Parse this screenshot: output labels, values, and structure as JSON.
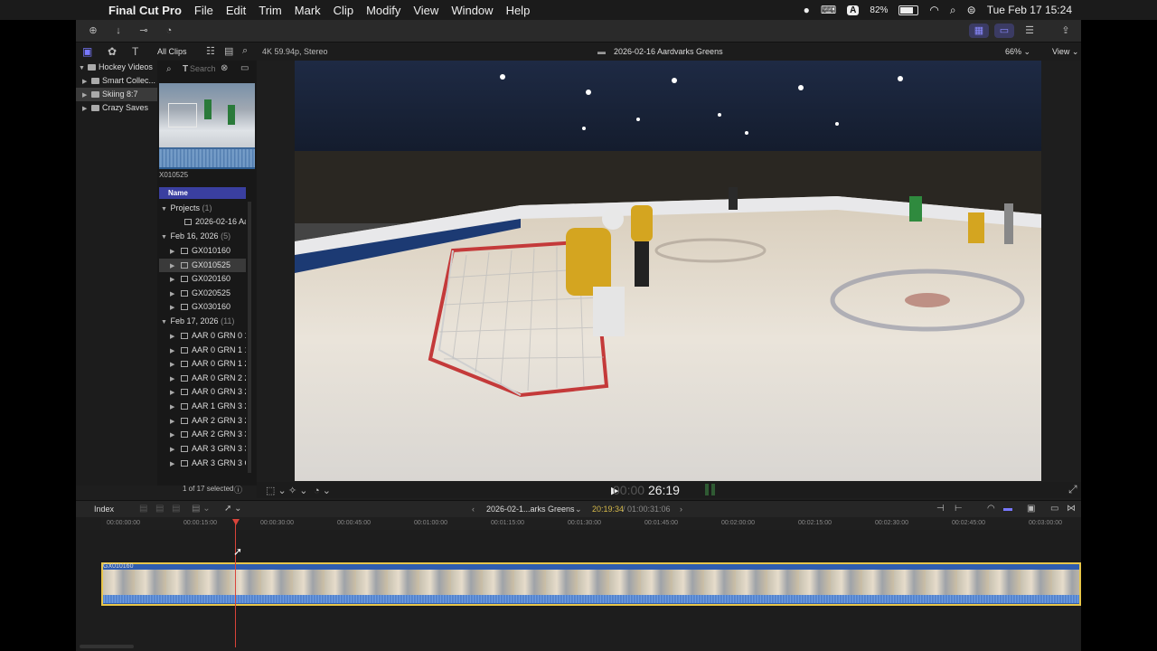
{
  "menubar": {
    "apple": "",
    "app_name": "Final Cut Pro",
    "menus": [
      "File",
      "Edit",
      "Trim",
      "Mark",
      "Clip",
      "Modify",
      "View",
      "Window",
      "Help"
    ],
    "battery": "82%",
    "battery_level": 0.82,
    "keyboard": "A",
    "clock": "Tue Feb 17  15:24"
  },
  "browser": {
    "clips_filter": "All Clips",
    "search_placeholder": "Search",
    "library": {
      "name": "Hockey Videos",
      "items": [
        "Smart Collec...",
        "Skiing 8:7",
        "Crazy Saves"
      ]
    },
    "preview_clip": "X010525",
    "column_header": "Name",
    "projects": {
      "label": "Projects",
      "count": "(1)",
      "items": [
        "2026-02-16 Aa"
      ]
    },
    "events": [
      {
        "label": "Feb 16, 2026",
        "count": "(5)",
        "clips": [
          "GX010160",
          "GX010525",
          "GX020160",
          "GX020525",
          "GX030160"
        ]
      },
      {
        "label": "Feb 17, 2026",
        "count": "(11)",
        "clips": [
          "AAR 0 GRN 0 1:",
          "AAR 0 GRN 1 1s",
          "AAR 0 GRN 1 2(",
          "AAR 0 GRN 2 2",
          "AAR 0 GRN 3 2",
          "AAR 1 GRN 3 2(",
          "AAR 2 GRN 3 2",
          "AAR 2 GRN 3 3",
          "AAR 3 GRN 3 3",
          "AAR 3 GRN 3 C"
        ]
      }
    ],
    "selection_status": "1 of 17 selected"
  },
  "viewer": {
    "format": "4K 59.94p, Stereo",
    "project_title": "2026-02-16 Aardvarks Greens",
    "zoom": "66%",
    "view_menu": "View",
    "timecode_dim": "00:00",
    "timecode": "26:19"
  },
  "timeline": {
    "index_label": "Index",
    "project_name": "2026-02-1...arks Greens",
    "position": "20:19:34",
    "duration": "/ 01:00:31:06",
    "ruler": [
      "00:00:00:00",
      "00:00:15:00",
      "00:00:30:00",
      "00:00:45:00",
      "00:01:00:00",
      "00:01:15:00",
      "00:01:30:00",
      "00:01:45:00",
      "00:02:00:00",
      "00:02:15:00",
      "00:02:30:00",
      "00:02:45:00",
      "00:03:00:00"
    ],
    "clip_name": "GX010160"
  }
}
